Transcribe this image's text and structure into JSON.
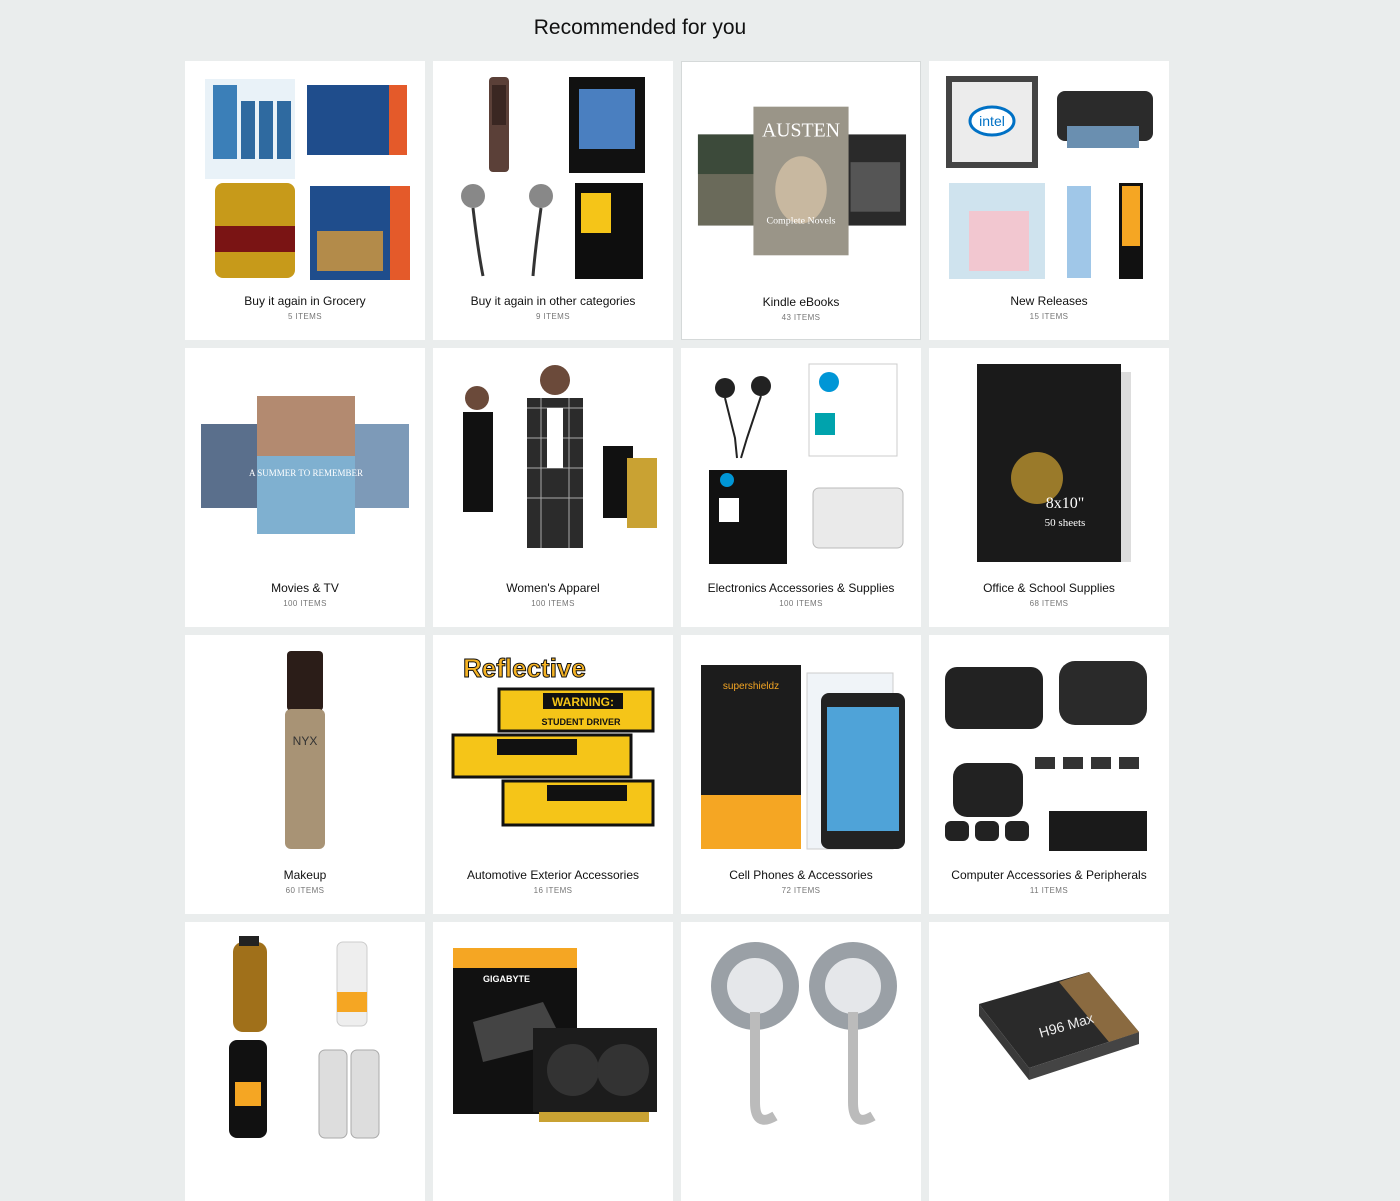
{
  "page": {
    "title": "Recommended for you"
  },
  "cards": [
    {
      "label": "Buy it again in Grocery",
      "count": "5 ITEMS",
      "image_icon": "grocery-collage-icon"
    },
    {
      "label": "Buy it again in other categories",
      "count": "9 ITEMS",
      "image_icon": "mixed-products-icon"
    },
    {
      "label": "Kindle eBooks",
      "count": "43 ITEMS",
      "image_icon": "ebook-covers-icon",
      "cover_title": "AUSTEN",
      "cover_subtitle": "Complete Novels"
    },
    {
      "label": "New Releases",
      "count": "15 ITEMS",
      "image_icon": "new-releases-icon",
      "badge_text": "intel"
    },
    {
      "label": "Movies & TV",
      "count": "100 ITEMS",
      "image_icon": "dvd-covers-icon",
      "cover_text": "A SUMMER TO REMEMBER"
    },
    {
      "label": "Women's Apparel",
      "count": "100 ITEMS",
      "image_icon": "apparel-icon"
    },
    {
      "label": "Electronics Accessories & Supplies",
      "count": "100 ITEMS",
      "image_icon": "electronics-supplies-icon"
    },
    {
      "label": "Office & School Supplies",
      "count": "68 ITEMS",
      "image_icon": "photo-paper-icon",
      "cover_text": "8x10\"",
      "cover_sub": "50 sheets"
    },
    {
      "label": "Makeup",
      "count": "60 ITEMS",
      "image_icon": "lip-cream-icon",
      "brand_text": "NYX"
    },
    {
      "label": "Automotive Exterior Accessories",
      "count": "16 ITEMS",
      "image_icon": "warning-magnets-icon",
      "headline": "Reflective",
      "sign_title": "WARNING:",
      "sign_sub": "STUDENT DRIVER"
    },
    {
      "label": "Cell Phones & Accessories",
      "count": "72 ITEMS",
      "image_icon": "screen-protector-icon",
      "brand_text": "supershieldz"
    },
    {
      "label": "Computer Accessories & Peripherals",
      "count": "11 ITEMS",
      "image_icon": "mini-keyboard-icon"
    },
    {
      "label": "",
      "count": "",
      "image_icon": "shampoo-bottles-icon"
    },
    {
      "label": "",
      "count": "",
      "image_icon": "graphics-card-icon",
      "brand_text": "GIGABYTE"
    },
    {
      "label": "",
      "count": "",
      "image_icon": "suction-hooks-icon"
    },
    {
      "label": "",
      "count": "",
      "image_icon": "tv-box-icon",
      "brand_text": "H96 Max"
    }
  ],
  "colors": {
    "background": "#eaeded",
    "card": "#ffffff",
    "count_text": "#767676"
  }
}
